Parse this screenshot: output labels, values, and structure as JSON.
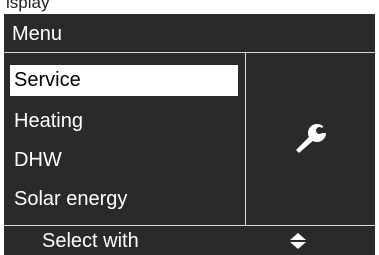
{
  "top_fragment": "isplay",
  "header": {
    "title": "Menu"
  },
  "menu": {
    "items": [
      {
        "label": "Service",
        "selected": true
      },
      {
        "label": "Heating",
        "selected": false
      },
      {
        "label": "DHW",
        "selected": false
      },
      {
        "label": "Solar energy",
        "selected": false
      }
    ]
  },
  "side_panel": {
    "icon": "wrench-icon"
  },
  "footer": {
    "hint": "Select with",
    "icon": "up-down-arrows-icon"
  },
  "colors": {
    "screen_bg": "#2a2a2a",
    "text": "#ffffff",
    "selection_bg": "#ffffff",
    "selection_text": "#000000",
    "divider": "#d8d8d8"
  }
}
